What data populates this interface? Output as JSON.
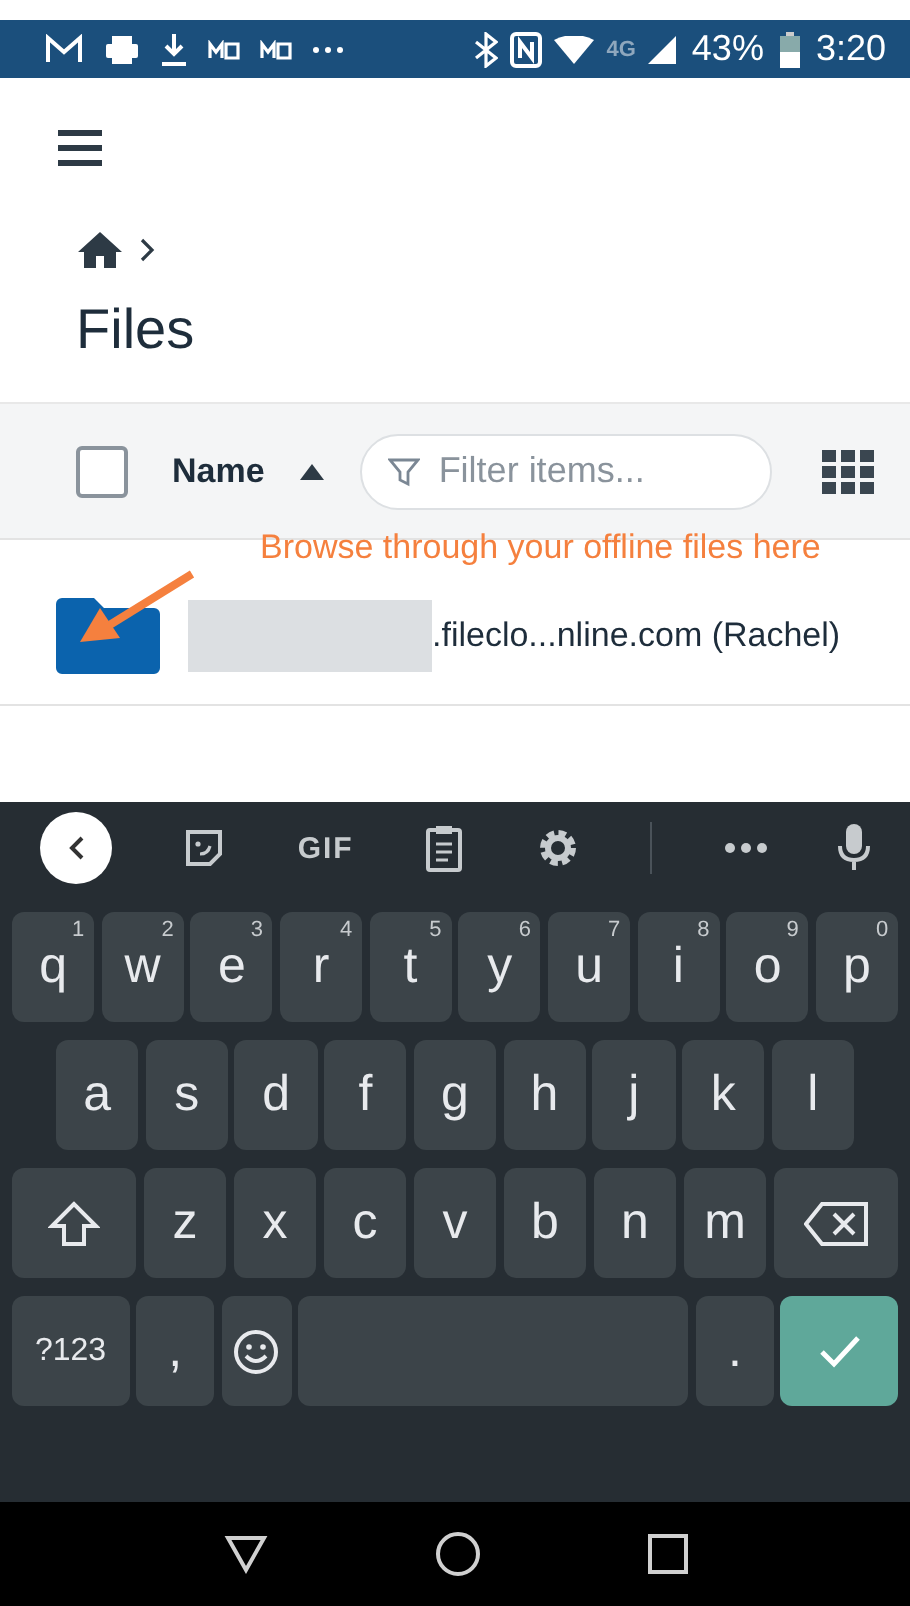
{
  "status_bar": {
    "battery": "43%",
    "time": "3:20",
    "network": "4G"
  },
  "breadcrumb": {
    "title": "Files"
  },
  "list_header": {
    "select_all": {
      "checked": false
    },
    "column": "Name",
    "sort_ascending": true,
    "filter": {
      "placeholder": "Filter items..."
    }
  },
  "annotation": "Browse through your offline files here",
  "files": [
    {
      "name": ".fileclo...nline.com (Rachel)",
      "kind": "folder"
    }
  ],
  "keyboard": {
    "toolbar": {
      "gif": "GIF"
    },
    "key_rows": [
      {
        "keys": [
          {
            "kind": "letter",
            "label": "q",
            "hint": "1"
          },
          {
            "kind": "letter",
            "label": "w",
            "hint": "2"
          },
          {
            "kind": "letter",
            "label": "e",
            "hint": "3"
          },
          {
            "kind": "letter",
            "label": "r",
            "hint": "4"
          },
          {
            "kind": "letter",
            "label": "t",
            "hint": "5"
          },
          {
            "kind": "letter",
            "label": "y",
            "hint": "6"
          },
          {
            "kind": "letter",
            "label": "u",
            "hint": "7"
          },
          {
            "kind": "letter",
            "label": "i",
            "hint": "8"
          },
          {
            "kind": "letter",
            "label": "o",
            "hint": "9"
          },
          {
            "kind": "letter",
            "label": "p",
            "hint": "0"
          }
        ]
      },
      {
        "keys": [
          {
            "kind": "letter",
            "label": "a"
          },
          {
            "kind": "letter",
            "label": "s"
          },
          {
            "kind": "letter",
            "label": "d"
          },
          {
            "kind": "letter",
            "label": "f"
          },
          {
            "kind": "letter",
            "label": "g"
          },
          {
            "kind": "letter",
            "label": "h"
          },
          {
            "kind": "letter",
            "label": "j"
          },
          {
            "kind": "letter",
            "label": "k"
          },
          {
            "kind": "letter",
            "label": "l"
          }
        ]
      },
      {
        "keys": [
          {
            "kind": "shift"
          },
          {
            "kind": "letter",
            "label": "z"
          },
          {
            "kind": "letter",
            "label": "x"
          },
          {
            "kind": "letter",
            "label": "c"
          },
          {
            "kind": "letter",
            "label": "v"
          },
          {
            "kind": "letter",
            "label": "b"
          },
          {
            "kind": "letter",
            "label": "n"
          },
          {
            "kind": "letter",
            "label": "m"
          },
          {
            "kind": "backspace"
          }
        ]
      },
      {
        "keys": [
          {
            "kind": "symbols",
            "label": "?123"
          },
          {
            "kind": "letter",
            "label": ","
          },
          {
            "kind": "emoji"
          },
          {
            "kind": "space"
          },
          {
            "kind": "letter",
            "label": "."
          },
          {
            "kind": "enter"
          }
        ]
      }
    ]
  }
}
